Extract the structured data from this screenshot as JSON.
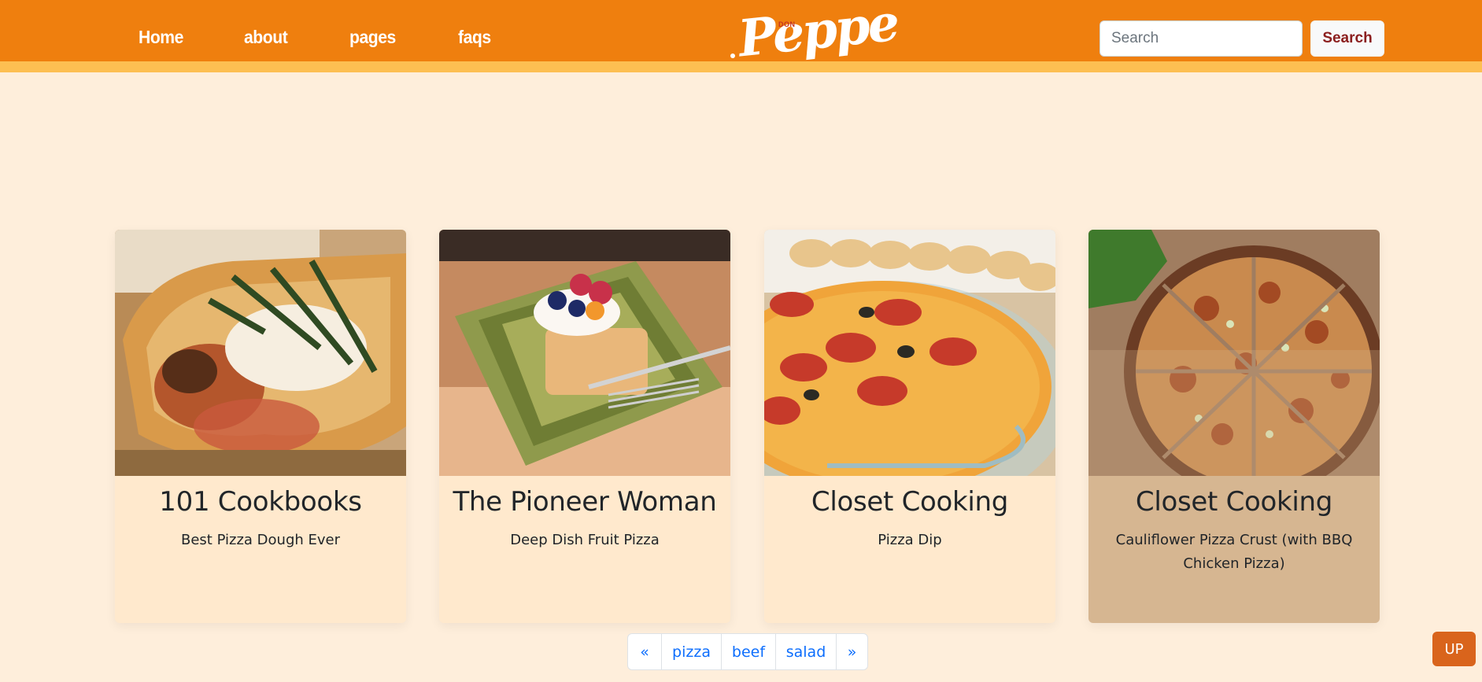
{
  "nav": {
    "links": [
      {
        "label": "Home"
      },
      {
        "label": "about"
      },
      {
        "label": "pages"
      },
      {
        "label": "faqs"
      }
    ]
  },
  "logo": {
    "small": "DON",
    "main": "Peppe"
  },
  "search": {
    "placeholder": "Search",
    "value": "",
    "button_label": "Search"
  },
  "cards": [
    {
      "publisher": "101 Cookbooks",
      "recipe": "Best Pizza Dough Ever",
      "image": "pizza-slice-basil"
    },
    {
      "publisher": "The Pioneer Woman",
      "recipe": "Deep Dish Fruit Pizza",
      "image": "fruit-pizza-plate"
    },
    {
      "publisher": "Closet Cooking",
      "recipe": "Pizza Dip",
      "image": "pizza-dip-pie-dish"
    },
    {
      "publisher": "Closet Cooking",
      "recipe": "Cauliflower Pizza Crust (with BBQ Chicken Pizza)",
      "image": "bbq-chicken-pizza"
    }
  ],
  "pagination": {
    "prev": "«",
    "items": [
      "pizza",
      "beef",
      "salad"
    ],
    "next": "»"
  },
  "up_button": "UP",
  "colors": {
    "navbar": "#ef7f0e",
    "navbar_border": "#fdbf52",
    "page_background": "#feeedb",
    "card_background": "#ffe9cd",
    "card_hover_background": "#d6b691",
    "link_blue": "#0d6efd",
    "up_button": "#d9641c"
  }
}
